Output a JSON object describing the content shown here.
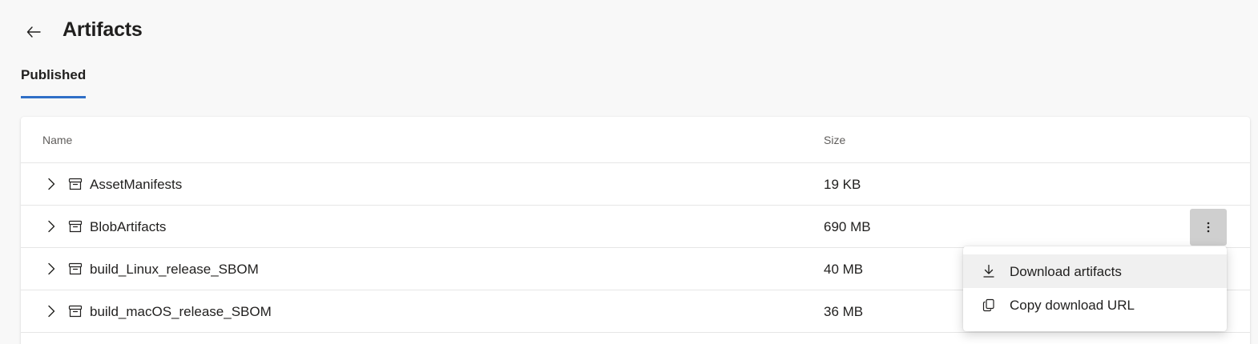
{
  "header": {
    "title": "Artifacts"
  },
  "tabs": [
    {
      "label": "Published",
      "selected": true
    }
  ],
  "table": {
    "columns": [
      "Name",
      "Size"
    ],
    "rows": [
      {
        "name": "AssetManifests",
        "size": "19 KB"
      },
      {
        "name": "BlobArtifacts",
        "size": "690 MB"
      },
      {
        "name": "build_Linux_release_SBOM",
        "size": "40 MB"
      },
      {
        "name": "build_macOS_release_SBOM",
        "size": "36 MB"
      }
    ]
  },
  "context_menu": {
    "items": [
      {
        "label": "Download artifacts",
        "icon": "download-icon"
      },
      {
        "label": "Copy download URL",
        "icon": "copy-icon"
      }
    ]
  },
  "colors": {
    "accent": "#2f6fc7",
    "background": "#f8f8f8",
    "card": "#ffffff",
    "more_button_active": "#cfcfcf",
    "menu_hover": "#f0f0f0"
  }
}
